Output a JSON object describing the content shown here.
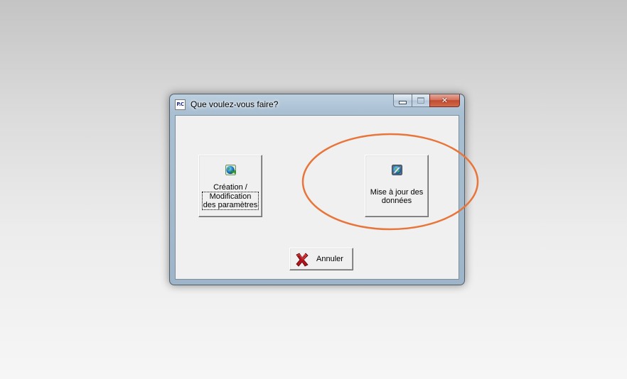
{
  "window": {
    "title": "Que voulez-vous faire?",
    "app_icon_text": "P.C"
  },
  "buttons": {
    "create": {
      "label_line1": "Création /",
      "label_line2": "Modification",
      "label_line3": "des paramètres",
      "icon": "globe-arrow-icon"
    },
    "update": {
      "label_line1": "Mise à jour des",
      "label_line2": "données",
      "icon": "globe-check-icon"
    },
    "cancel": {
      "label": "Annuler",
      "icon": "red-x-icon"
    }
  },
  "caption_buttons": {
    "close_glyph": "✕"
  },
  "colors": {
    "annotation_ellipse": "#e8753a",
    "close_button": "#c9553a",
    "cancel_icon": "#b3131b"
  }
}
